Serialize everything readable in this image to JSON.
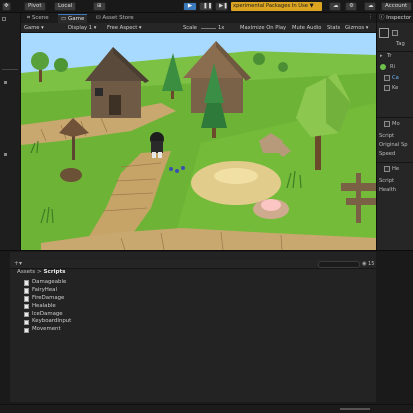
{
  "toolbar": {
    "pivot": "Pivot",
    "local": "Local",
    "packages_warning": "xperimental Packages In Use ▼",
    "account": "Account"
  },
  "scene_tabs": [
    "Scene",
    "Game",
    "Asset Store"
  ],
  "game_bar": {
    "display_mode": "Game",
    "display": "Display 1",
    "aspect": "Free Aspect",
    "scale_label": "Scale",
    "scale_value": "1x",
    "maximize": "Maximize On Play",
    "mute": "Mute Audio",
    "stats": "Stats",
    "gizmos": "Gizmos ▾"
  },
  "inspector": {
    "title": "Inspector",
    "tag": "Tag",
    "components": [
      "Tr",
      "Ri",
      "Ca",
      "Ke",
      "Mo",
      "He"
    ],
    "fields": [
      "Script",
      "Original Sp",
      "Speed",
      "Script",
      "Health"
    ]
  },
  "project": {
    "breadcrumb_root": "Assets",
    "breadcrumb_sep": ">",
    "breadcrumb_leaf": "Scripts",
    "count": "15",
    "files": [
      "Damageable",
      "FairyHeal",
      "FireDamage",
      "Healable",
      "IceDamage",
      "KeyboardInput",
      "Movement"
    ]
  }
}
